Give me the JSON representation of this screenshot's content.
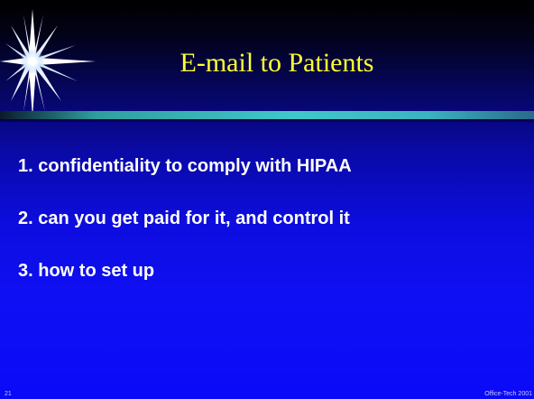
{
  "slide": {
    "title": "E-mail to Patients",
    "bullets": [
      "1. confidentiality to comply with HIPAA",
      "2. can you get paid for it, and control it",
      "3. how to set up"
    ],
    "slide_number": "21",
    "footer": "Office-Tech 2001"
  },
  "colors": {
    "title": "#ffff33",
    "bullet_text": "#ffffff",
    "divider": "#40c8c8",
    "background_top": "#000000",
    "background_bottom": "#0a0af8"
  },
  "icons": {
    "logo": "starburst-icon"
  }
}
